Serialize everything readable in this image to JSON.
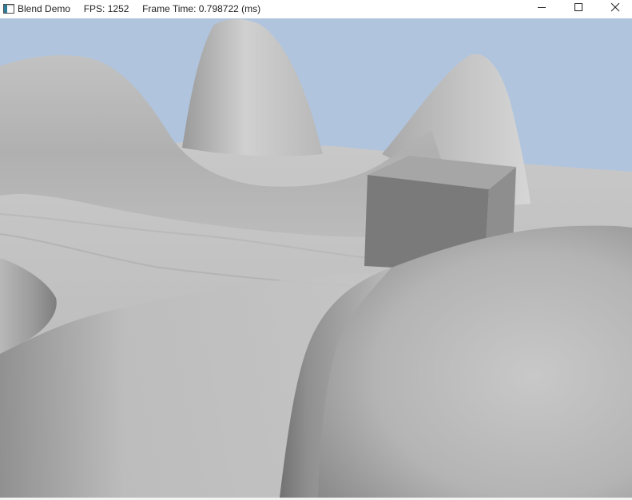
{
  "window": {
    "app_title": "Blend Demo",
    "fps_text": "FPS: 1252",
    "frame_time_text": "Frame Time: 0.798722 (ms)",
    "minimize_icon": "minimize-icon",
    "maximize_icon": "maximize-icon",
    "close_icon": "close-icon"
  },
  "scene": {
    "sky_color": "#b0c4de",
    "terrain_color": "#bdbdbd",
    "box_color": "#7a7a7a"
  }
}
